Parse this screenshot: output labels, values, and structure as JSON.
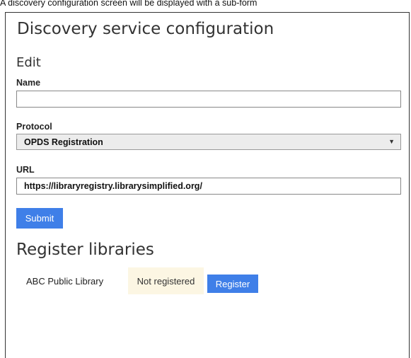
{
  "caption": "A discovery configuration screen will be displayed with a sub-form",
  "page_title": "Discovery service configuration",
  "edit_section": {
    "title": "Edit",
    "name_label": "Name",
    "name_value": "",
    "protocol_label": "Protocol",
    "protocol_selected": "OPDS Registration",
    "url_label": "URL",
    "url_value": "https://libraryregistry.librarysimplified.org/",
    "submit_label": "Submit"
  },
  "register_section": {
    "title": "Register libraries",
    "libraries": [
      {
        "name": "ABC Public Library",
        "status": "Not registered",
        "action_label": "Register"
      }
    ]
  },
  "colors": {
    "primary_button": "#3f7fe8",
    "status_badge_bg": "#fcf6e3",
    "select_bg": "#ececec"
  },
  "icons": {
    "select_chevron": "chevron-down-icon"
  }
}
